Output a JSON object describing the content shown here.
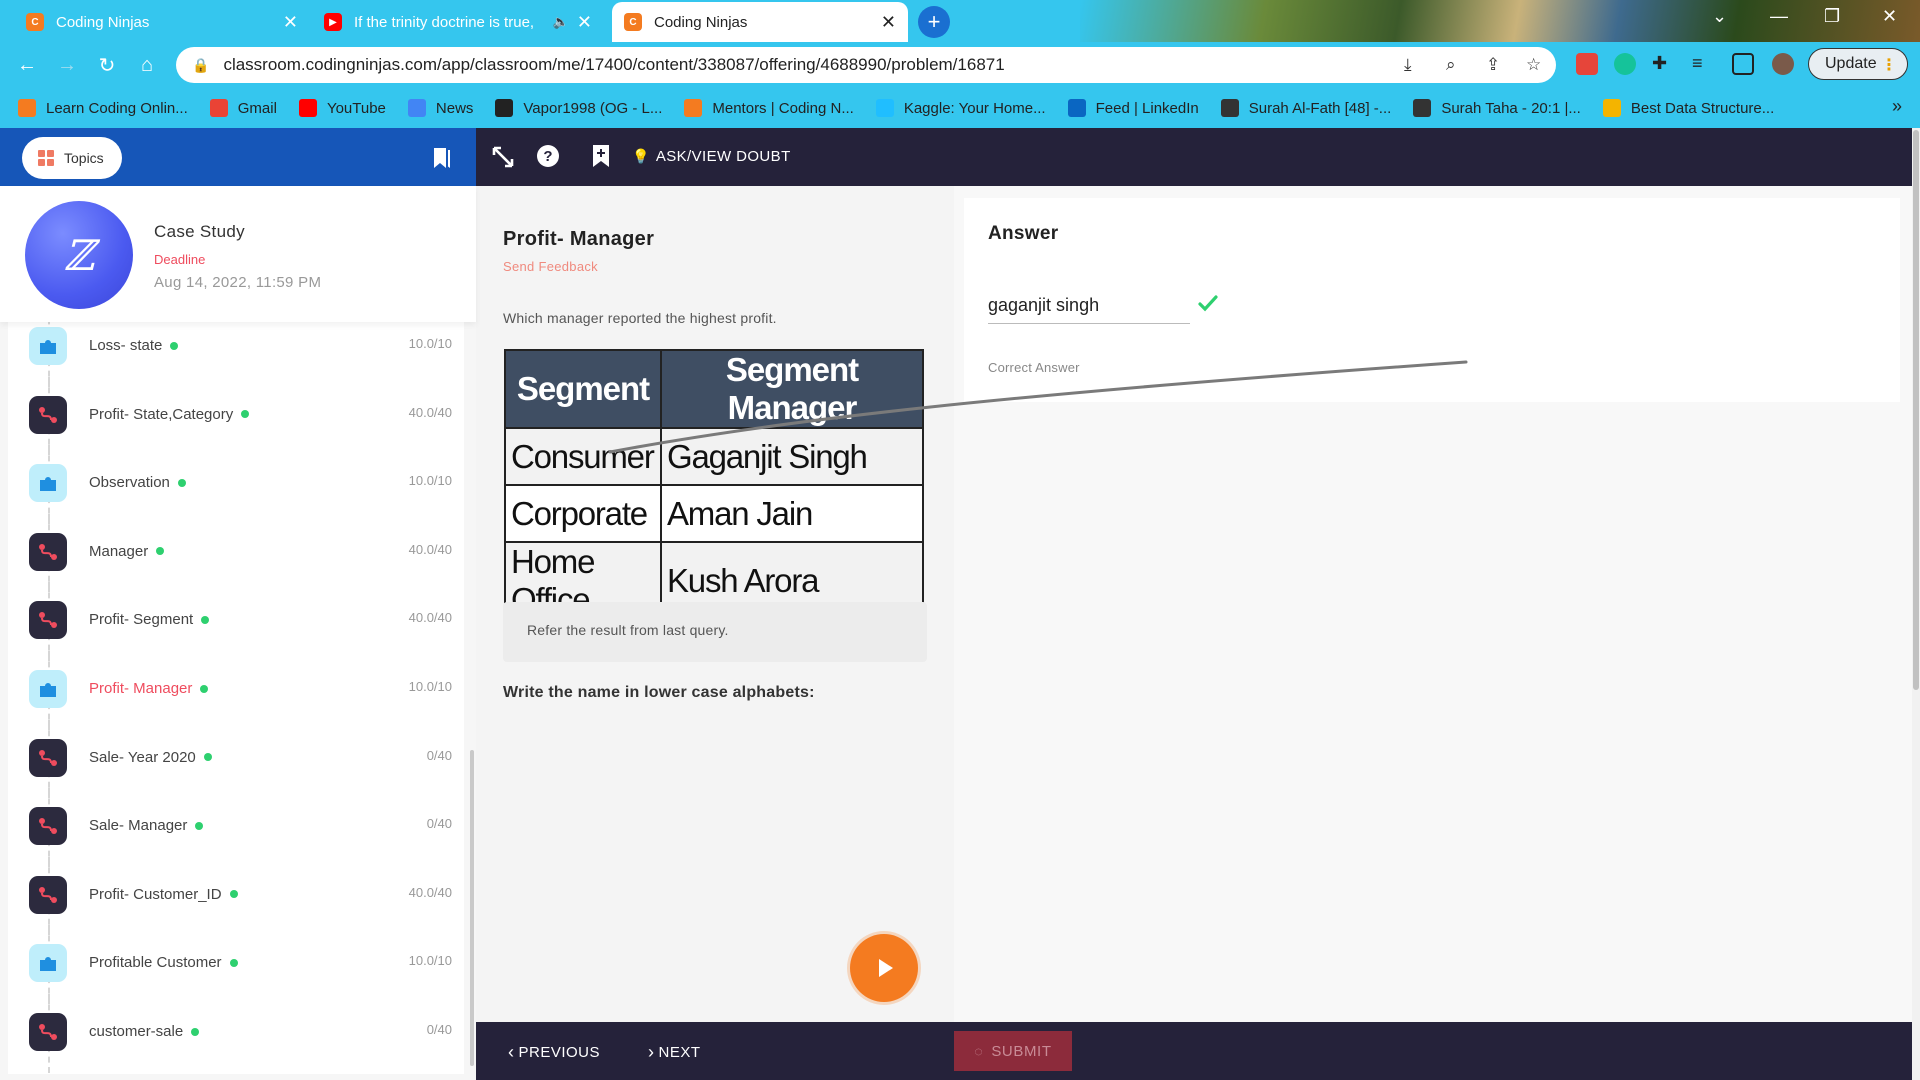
{
  "browser": {
    "tabs": [
      {
        "title": "Coding Ninjas",
        "active": false,
        "favicon": "coding-ninjas-favicon"
      },
      {
        "title": "If the trinity doctrine is true,",
        "active": false,
        "favicon": "youtube-favicon"
      },
      {
        "title": "Coding Ninjas",
        "active": true,
        "favicon": "coding-ninjas-favicon"
      }
    ],
    "url": "classroom.codingninjas.com/app/classroom/me/17400/content/338087/offering/4688990/problem/16871",
    "update_label": "Update",
    "bookmarks": [
      {
        "label": "Learn Coding Onlin...",
        "icon": "coding-ninjas-icon",
        "color": "#f47b20"
      },
      {
        "label": "Gmail",
        "icon": "gmail-icon",
        "color": "#ea4335"
      },
      {
        "label": "YouTube",
        "icon": "youtube-icon",
        "color": "#ff0000"
      },
      {
        "label": "News",
        "icon": "google-news-icon",
        "color": "#4285f4"
      },
      {
        "label": "Vapor1998 (OG - L...",
        "icon": "github-icon",
        "color": "#222222"
      },
      {
        "label": "Mentors | Coding N...",
        "icon": "coding-ninjas-icon",
        "color": "#f47b20"
      },
      {
        "label": "Kaggle: Your Home...",
        "icon": "kaggle-icon",
        "color": "#20beff"
      },
      {
        "label": "Feed | LinkedIn",
        "icon": "linkedin-icon",
        "color": "#0a66c2"
      },
      {
        "label": "Surah Al-Fath [48] -...",
        "icon": "quran-icon",
        "color": "#333333"
      },
      {
        "label": "Surah Taha - 20:1 |...",
        "icon": "quran-icon",
        "color": "#333333"
      },
      {
        "label": "Best Data Structure...",
        "icon": "chart-icon",
        "color": "#f4b400"
      }
    ]
  },
  "header": {
    "topics_label": "Topics",
    "ask_doubt_label": "ASK/VIEW DOUBT"
  },
  "case_study": {
    "title": "Case Study",
    "deadline_label": "Deadline",
    "deadline": "Aug 14, 2022, 11:59 PM"
  },
  "topics": [
    {
      "name": "Loss- state",
      "score": "10.0/10",
      "type": "mcq",
      "done": true,
      "active": false
    },
    {
      "name": "Profit- State,Category",
      "score": "40.0/40",
      "type": "code",
      "done": true,
      "active": false
    },
    {
      "name": "Observation",
      "score": "10.0/10",
      "type": "mcq",
      "done": true,
      "active": false
    },
    {
      "name": "Manager",
      "score": "40.0/40",
      "type": "code",
      "done": true,
      "active": false
    },
    {
      "name": "Profit- Segment",
      "score": "40.0/40",
      "type": "code",
      "done": true,
      "active": false
    },
    {
      "name": "Profit- Manager",
      "score": "10.0/10",
      "type": "mcq",
      "done": true,
      "active": true
    },
    {
      "name": "Sale- Year 2020",
      "score": "0/40",
      "type": "code",
      "done": true,
      "active": false
    },
    {
      "name": "Sale- Manager",
      "score": "0/40",
      "type": "code",
      "done": true,
      "active": false
    },
    {
      "name": "Profit- Customer_ID",
      "score": "40.0/40",
      "type": "code",
      "done": true,
      "active": false
    },
    {
      "name": "Profitable Customer",
      "score": "10.0/10",
      "type": "mcq",
      "done": true,
      "active": false
    },
    {
      "name": "customer-sale",
      "score": "0/40",
      "type": "code",
      "done": true,
      "active": false
    }
  ],
  "problem": {
    "title": "Profit- Manager",
    "send_feedback": "Send Feedback",
    "question": "Which manager reported the highest profit.",
    "table": {
      "headers": [
        "Segment",
        "Segment Manager"
      ],
      "rows": [
        [
          "Consumer",
          "Gaganjit Singh"
        ],
        [
          "Corporate",
          "Aman Jain"
        ],
        [
          "Home Office",
          "Kush Arora"
        ]
      ]
    },
    "hint": "Refer the result from last query.",
    "instruction": "Write the name in lower case alphabets:"
  },
  "answer": {
    "title": "Answer",
    "value": "gaganjit singh",
    "status": "Correct Answer"
  },
  "footer": {
    "previous_label": "PREVIOUS",
    "next_label": "NEXT",
    "submit_label": "SUBMIT"
  },
  "colors": {
    "accent_red": "#ef4c5e",
    "success_green": "#2ed06f",
    "header_dark": "#25223a",
    "left_header_blue": "#1656b8",
    "browser_chrome": "#35c6ee",
    "play_orange": "#f47b20"
  }
}
